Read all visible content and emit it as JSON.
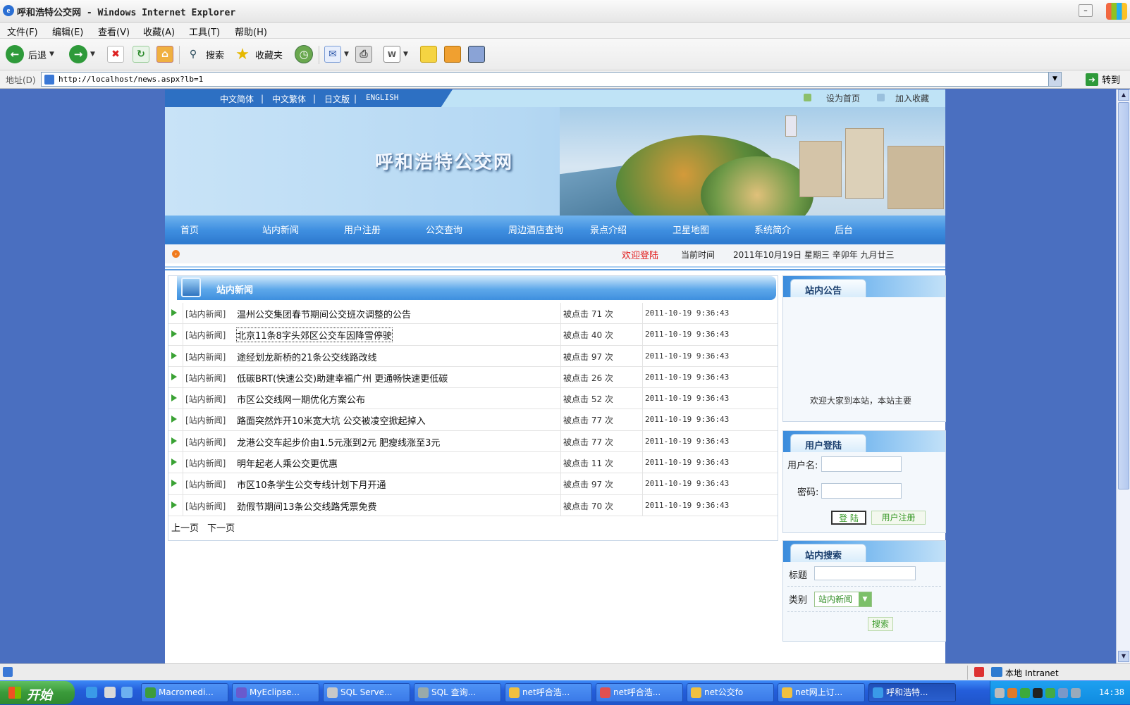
{
  "window": {
    "title": "呼和浩特公交网 - Windows Internet Explorer",
    "minimize_glyph": "–",
    "app_icon_glyph": "e"
  },
  "menu": [
    "文件(F)",
    "编辑(E)",
    "查看(V)",
    "收藏(A)",
    "工具(T)",
    "帮助(H)"
  ],
  "toolbar": {
    "back": "后退",
    "search": "搜索",
    "favorites": "收藏夹",
    "back_glyph": "←",
    "forward_glyph": "→",
    "stop_glyph": "✖",
    "refresh_glyph": "↻",
    "word_glyph": "W"
  },
  "address": {
    "label": "地址(D)",
    "url": "http://localhost/news.aspx?lb=1",
    "go": "转到",
    "go_glyph": "➜"
  },
  "site": {
    "languages": [
      "中文简体",
      "中文繁体",
      "日文版",
      "ENGLISH"
    ],
    "set_home": "设为首页",
    "add_favorite": "加入收藏",
    "title": "呼和浩特公交网",
    "nav": [
      "首页",
      "站内新闻",
      "用户注册",
      "公交查询",
      "周边酒店查询",
      "景点介绍",
      "卫星地图",
      "系统简介",
      "后台"
    ],
    "welcome": "欢迎登陆",
    "time_label": "当前时间",
    "time_value": "2011年10月19日 星期三 辛卯年 九月廿三"
  },
  "news": {
    "header": "站内新闻",
    "rows": [
      {
        "cat": "[站内新闻]",
        "title": "温州公交集团春节期间公交班次调整的公告",
        "hits": "被点击 71 次",
        "date": "2011-10-19 9:36:43"
      },
      {
        "cat": "[站内新闻]",
        "title": "北京11条8字头郊区公交车因降雪停驶",
        "hits": "被点击 40 次",
        "date": "2011-10-19 9:36:43"
      },
      {
        "cat": "[站内新闻]",
        "title": "途经划龙新桥的21条公交线路改线",
        "hits": "被点击 97 次",
        "date": "2011-10-19 9:36:43"
      },
      {
        "cat": "[站内新闻]",
        "title": "低碳BRT(快速公交)助建幸福广州 更通畅快速更低碳",
        "hits": "被点击 26 次",
        "date": "2011-10-19 9:36:43"
      },
      {
        "cat": "[站内新闻]",
        "title": "市区公交线网一期优化方案公布",
        "hits": "被点击 52 次",
        "date": "2011-10-19 9:36:43"
      },
      {
        "cat": "[站内新闻]",
        "title": "路面突然炸开10米宽大坑 公交被凌空掀起掉入",
        "hits": "被点击 77 次",
        "date": "2011-10-19 9:36:43"
      },
      {
        "cat": "[站内新闻]",
        "title": "龙港公交车起步价由1.5元涨到2元 肥瘦线涨至3元",
        "hits": "被点击 77 次",
        "date": "2011-10-19 9:36:43"
      },
      {
        "cat": "[站内新闻]",
        "title": "明年起老人乘公交更优惠",
        "hits": "被点击 11 次",
        "date": "2011-10-19 9:36:43"
      },
      {
        "cat": "[站内新闻]",
        "title": "市区10条学生公交专线计划下月开通",
        "hits": "被点击 97 次",
        "date": "2011-10-19 9:36:43"
      },
      {
        "cat": "[站内新闻]",
        "title": "劲假节期间13条公交线路凭票免费",
        "hits": "被点击 70 次",
        "date": "2011-10-19 9:36:43"
      }
    ],
    "prev": "上一页",
    "next": "下一页"
  },
  "notice": {
    "header": "站内公告",
    "text": "欢迎大家到本站，本站主要"
  },
  "login": {
    "header": "用户登陆",
    "username_label": "用户名:",
    "password_label": "密码:",
    "login_btn": "登 陆",
    "register_btn": "用户注册"
  },
  "search": {
    "header": "站内搜索",
    "title_label": "标题",
    "type_label": "类别",
    "type_value": "站内新闻",
    "search_btn": "搜索"
  },
  "status": {
    "zone": "本地 Intranet"
  },
  "taskbar": {
    "start": "开始",
    "tasks": [
      "Macromedi...",
      "MyEclipse...",
      "SQL Serve...",
      "SQL 查询...",
      "net呼合浩...",
      "net呼合浩...",
      "net公交fo",
      "net网上订...",
      "呼和浩特..."
    ],
    "clock": "14:38"
  }
}
